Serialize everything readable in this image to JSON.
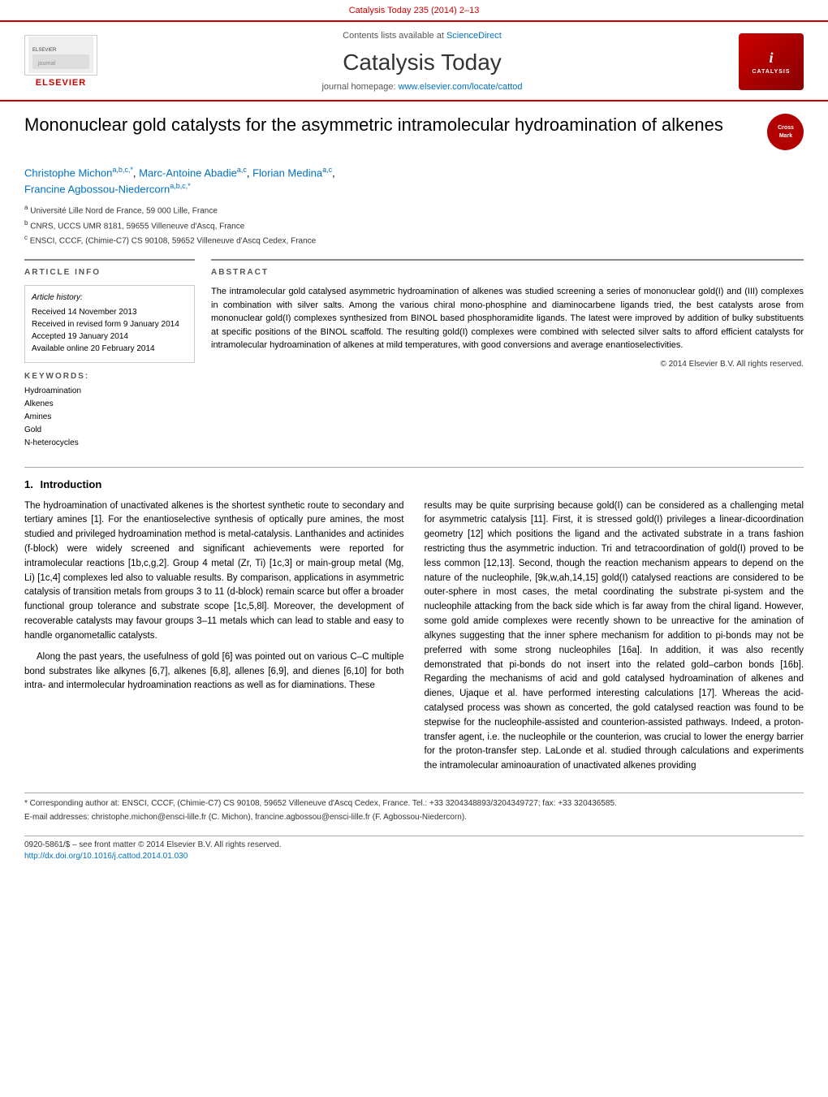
{
  "page": {
    "citation": "Catalysis Today 235 (2014) 2–13",
    "topbar": {
      "text": "Contents lists available at ScienceDirect"
    },
    "journal": {
      "title": "Catalysis Today",
      "homepage_text": "journal homepage: ",
      "homepage_url": "www.elsevier.com/locate/cattod",
      "sciencedirect_label": "ScienceDirect"
    },
    "article": {
      "title": "Mononuclear gold catalysts for the asymmetric intramolecular hydroamination of alkenes",
      "crossmark": "CrossMark",
      "authors": [
        {
          "name": "Christophe Michon",
          "superscript": "a,b,c,*"
        },
        {
          "name": "Marc-Antoine Abadie",
          "superscript": "a,c"
        },
        {
          "name": "Florian Medina",
          "superscript": "a,c"
        },
        {
          "name": "Francine Agbossou-Niedercorn",
          "superscript": "a,b,c,*"
        }
      ],
      "affiliations": [
        {
          "key": "a",
          "text": "Université Lille Nord de France, 59 000 Lille, France"
        },
        {
          "key": "b",
          "text": "CNRS, UCCS UMR 8181, 59655 Villeneuve d'Ascq, France"
        },
        {
          "key": "c",
          "text": "ENSCI, CCCF, (Chimie-C7) CS 90108, 59652 Villeneuve d'Ascq Cedex, France"
        }
      ],
      "article_info": {
        "label": "Article history:",
        "dates": [
          "Received 14 November 2013",
          "Received in revised form 9 January 2014",
          "Accepted 19 January 2014",
          "Available online 20 February 2014"
        ]
      },
      "keywords_label": "Keywords:",
      "keywords": [
        "Hydroamination",
        "Alkenes",
        "Amines",
        "Gold",
        "N-heterocycles"
      ],
      "abstract_header": "ABSTRACT",
      "abstract": "The intramolecular gold catalysed asymmetric hydroamination of alkenes was studied screening a series of mononuclear gold(I) and (III) complexes in combination with silver salts. Among the various chiral mono-phosphine and diaminocarbene ligands tried, the best catalysts arose from mononuclear gold(I) complexes synthesized from BINOL based phosphoramidite ligands. The latest were improved by addition of bulky substituents at specific positions of the BINOL scaffold. The resulting gold(I) complexes were combined with selected silver salts to afford efficient catalysts for intramolecular hydroamination of alkenes at mild temperatures, with good conversions and average enantioselectivities.",
      "copyright": "© 2014 Elsevier B.V. All rights reserved.",
      "article_info_header": "ARTICLE INFO"
    },
    "introduction": {
      "number": "1.",
      "title": "Introduction",
      "paragraphs": [
        "The hydroamination of unactivated alkenes is the shortest synthetic route to secondary and tertiary amines [1]. For the enantioselective synthesis of optically pure amines, the most studied and privileged hydroamination method is metal-catalysis. Lanthanides and actinides (f-block) were widely screened and significant achievements were reported for intramolecular reactions [1b,c,g,2]. Group 4 metal (Zr, Ti) [1c,3] or main-group metal (Mg, Li) [1c,4] complexes led also to valuable results. By comparison, applications in asymmetric catalysis of transition metals from groups 3 to 11 (d-block) remain scarce but offer a broader functional group tolerance and substrate scope [1c,5,8l]. Moreover, the development of recoverable catalysts may favour groups 3–11 metals which can lead to stable and easy to handle organometallic catalysts.",
        "Along the past years, the usefulness of gold [6] was pointed out on various C–C multiple bond substrates like alkynes [6,7], alkenes [6,8], allenes [6,9], and dienes [6,10] for both intra- and intermolecular hydroamination reactions as well as for diaminations. These"
      ],
      "right_paragraphs": [
        "results may be quite surprising because gold(I) can be considered as a challenging metal for asymmetric catalysis [11]. First, it is stressed gold(I) privileges a linear-dicoordination geometry [12] which positions the ligand and the activated substrate in a trans fashion restricting thus the asymmetric induction. Tri and tetracoordination of gold(I) proved to be less common [12,13]. Second, though the reaction mechanism appears to depend on the nature of the nucleophile, [9k,w,ah,14,15] gold(I) catalysed reactions are considered to be outer-sphere in most cases, the metal coordinating the substrate pi-system and the nucleophile attacking from the back side which is far away from the chiral ligand. However, some gold amide complexes were recently shown to be unreactive for the amination of alkynes suggesting that the inner sphere mechanism for addition to pi-bonds may not be preferred with some strong nucleophiles [16a]. In addition, it was also recently demonstrated that pi-bonds do not insert into the related gold–carbon bonds [16b]. Regarding the mechanisms of acid and gold catalysed hydroamination of alkenes and dienes, Ujaque et al. have performed interesting calculations [17]. Whereas the acid-catalysed process was shown as concerted, the gold catalysed reaction was found to be stepwise for the nucleophile-assisted and counterion-assisted pathways. Indeed, a proton-transfer agent, i.e. the nucleophile or the counterion, was crucial to lower the energy barrier for the proton-transfer step. LaLonde et al. studied through calculations and experiments the intramolecular aminoauration of unactivated alkenes providing"
      ]
    },
    "footnotes": [
      "* Corresponding author at: ENSCI, CCCF, (Chimie-C7) CS 90108, 59652 Villeneuve d'Ascq Cedex, France. Tel.: +33 3204348893/3204349727; fax: +33 320436585.",
      "E-mail addresses: christophe.michon@ensci-lille.fr (C. Michon), francine.agbossou@ensci-lille.fr (F. Agbossou-Niedercorn)."
    ],
    "bottom_bar": {
      "license": "0920-5861/$ – see front matter © 2014 Elsevier B.V. All rights reserved.",
      "doi": "http://dx.doi.org/10.1016/j.cattod.2014.01.030",
      "doi_label": "http://dx.doi.org/10.1016/j.cattod.2014.01.030"
    }
  }
}
